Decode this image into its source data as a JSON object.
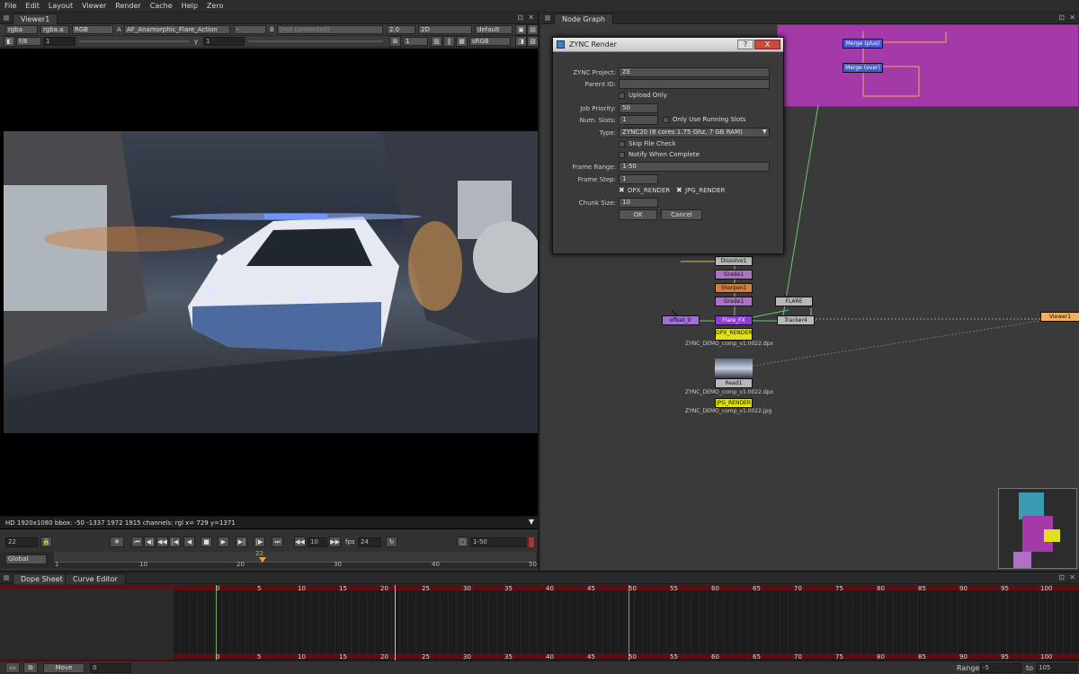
{
  "menu": [
    "File",
    "Edit",
    "Layout",
    "Viewer",
    "Render",
    "Cache",
    "Help",
    "Zero"
  ],
  "viewer": {
    "tab": "Viewer1",
    "channels": "rgba",
    "channel2": "rgba.a",
    "colorspace": "RGB",
    "input_a_label": "A",
    "input_a": "AF_Anamorphic_Flare_Action",
    "input_a2": "-",
    "input_b_label": "B",
    "input_b": "(not connected)",
    "zoom": "2.0",
    "view": "2D",
    "lut": "default",
    "fstop": "f/8",
    "gain": "1",
    "gamma_label": "y",
    "gamma": "1",
    "proxy": "1",
    "lut2": "sRGB",
    "status": "HD 1920x1080 bbox: -50 -1337 1972 1915 channels: rgl  x= 729 y=1371",
    "frame": "22",
    "increment": "10",
    "fps_label": "fps",
    "fps": "24",
    "range": "1-50",
    "global": "Global",
    "ruler": [
      "1",
      "10",
      "20",
      "30",
      "40",
      "50"
    ],
    "current_marker": "22"
  },
  "nodegraph": {
    "tab": "Node Graph",
    "nodes": {
      "merge_plus": "Merge (plus)",
      "merge_over": "Merge (over)",
      "dissolve": "Dissolve1",
      "grade": "Grade1",
      "sharpen": "Sharpen1",
      "flare": "FLARE",
      "offset": "offset_tr",
      "tracker": "Tracker4",
      "viewer": "Viewer1",
      "flare_fx": "Flare_FX",
      "dpx_render": "DPX_RENDER",
      "dpx_file": "ZYNC_DEMO_comp_v1.0022.dpx",
      "jpg_render": "JPG_RENDER",
      "read": "Read1",
      "read_file": "ZYNC_DEMO_comp_v1.0022.dpx",
      "jpg_file": "ZYNC_DEMO_comp_v1.0022.jpg"
    }
  },
  "dialog": {
    "title": "ZYNC Render",
    "help": "?",
    "close": "X",
    "project_label": "ZYNC Project:",
    "project": "ZE",
    "parent_label": "Parent ID:",
    "parent": "",
    "upload_only": "Upload Only",
    "priority_label": "Job Priority:",
    "priority": "50",
    "slots_label": "Num. Slots:",
    "slots": "1",
    "running_slots": "Only Use Running Slots",
    "type_label": "Type:",
    "type": "ZYNC20 (8 cores 1.75 Ghz, 7 GB RAM)",
    "skip_check": "Skip File Check",
    "notify": "Notify When Complete",
    "range_label": "Frame Range:",
    "range": "1-50",
    "step_label": "Frame Step:",
    "step": "1",
    "write1": "DPX_RENDER",
    "write2": "JPG_RENDER",
    "chunk_label": "Chunk Size:",
    "chunk": "10",
    "ok": "OK",
    "cancel": "Cancel"
  },
  "dopesheet": {
    "tab1": "Dope Sheet",
    "tab2": "Curve Editor",
    "ruler": [
      "0",
      "5",
      "10",
      "15",
      "20",
      "25",
      "30",
      "35",
      "40",
      "45",
      "50",
      "55",
      "60",
      "65",
      "70",
      "75",
      "80",
      "85",
      "90",
      "95",
      "100"
    ]
  },
  "bottombar": {
    "mode": "Move",
    "value": "0",
    "range_label": "Range",
    "range_from": "-5",
    "to_label": "to",
    "range_to": "105"
  }
}
